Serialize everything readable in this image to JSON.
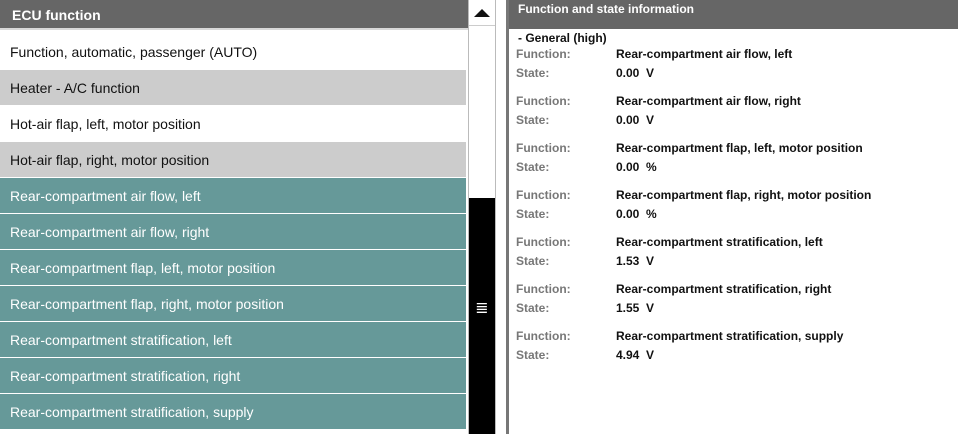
{
  "left_panel": {
    "title": "ECU function",
    "items": [
      {
        "label": "Function, automatic, passenger (AUTO)",
        "style": "white"
      },
      {
        "label": "Heater - A/C function",
        "style": "gray"
      },
      {
        "label": "Hot-air flap, left, motor position",
        "style": "white"
      },
      {
        "label": "Hot-air flap, right, motor position",
        "style": "gray"
      },
      {
        "label": "Rear-compartment air flow, left",
        "style": "teal"
      },
      {
        "label": "Rear-compartment air flow, right",
        "style": "teal"
      },
      {
        "label": "Rear-compartment flap, left, motor position",
        "style": "teal"
      },
      {
        "label": "Rear-compartment flap, right, motor position",
        "style": "teal"
      },
      {
        "label": "Rear-compartment stratification, left",
        "style": "teal"
      },
      {
        "label": "Rear-compartment stratification, right",
        "style": "teal"
      },
      {
        "label": "Rear-compartment stratification, supply",
        "style": "teal"
      }
    ]
  },
  "scrollbar": {
    "up_icon": "triangle-up-icon",
    "grip_icon": "grip-lines-icon",
    "grip_glyph": "≣"
  },
  "right_panel": {
    "title": "Function and state information",
    "group": "- General (high)",
    "function_label": "Function:",
    "state_label": "State:",
    "entries": [
      {
        "function": "Rear-compartment air flow, left",
        "state": "0.00  V"
      },
      {
        "function": "Rear-compartment air flow, right",
        "state": "0.00  V"
      },
      {
        "function": "Rear-compartment flap, left, motor position",
        "state": "0.00  %"
      },
      {
        "function": "Rear-compartment flap, right, motor position",
        "state": "0.00  %"
      },
      {
        "function": "Rear-compartment stratification, left",
        "state": "1.53  V"
      },
      {
        "function": "Rear-compartment stratification, right",
        "state": "1.55  V"
      },
      {
        "function": "Rear-compartment stratification, supply",
        "state": "4.94  V"
      }
    ]
  },
  "colors": {
    "header_bg": "#666666",
    "row_gray": "#cccccc",
    "row_teal": "#669999",
    "scroll_thumb": "#000000"
  }
}
